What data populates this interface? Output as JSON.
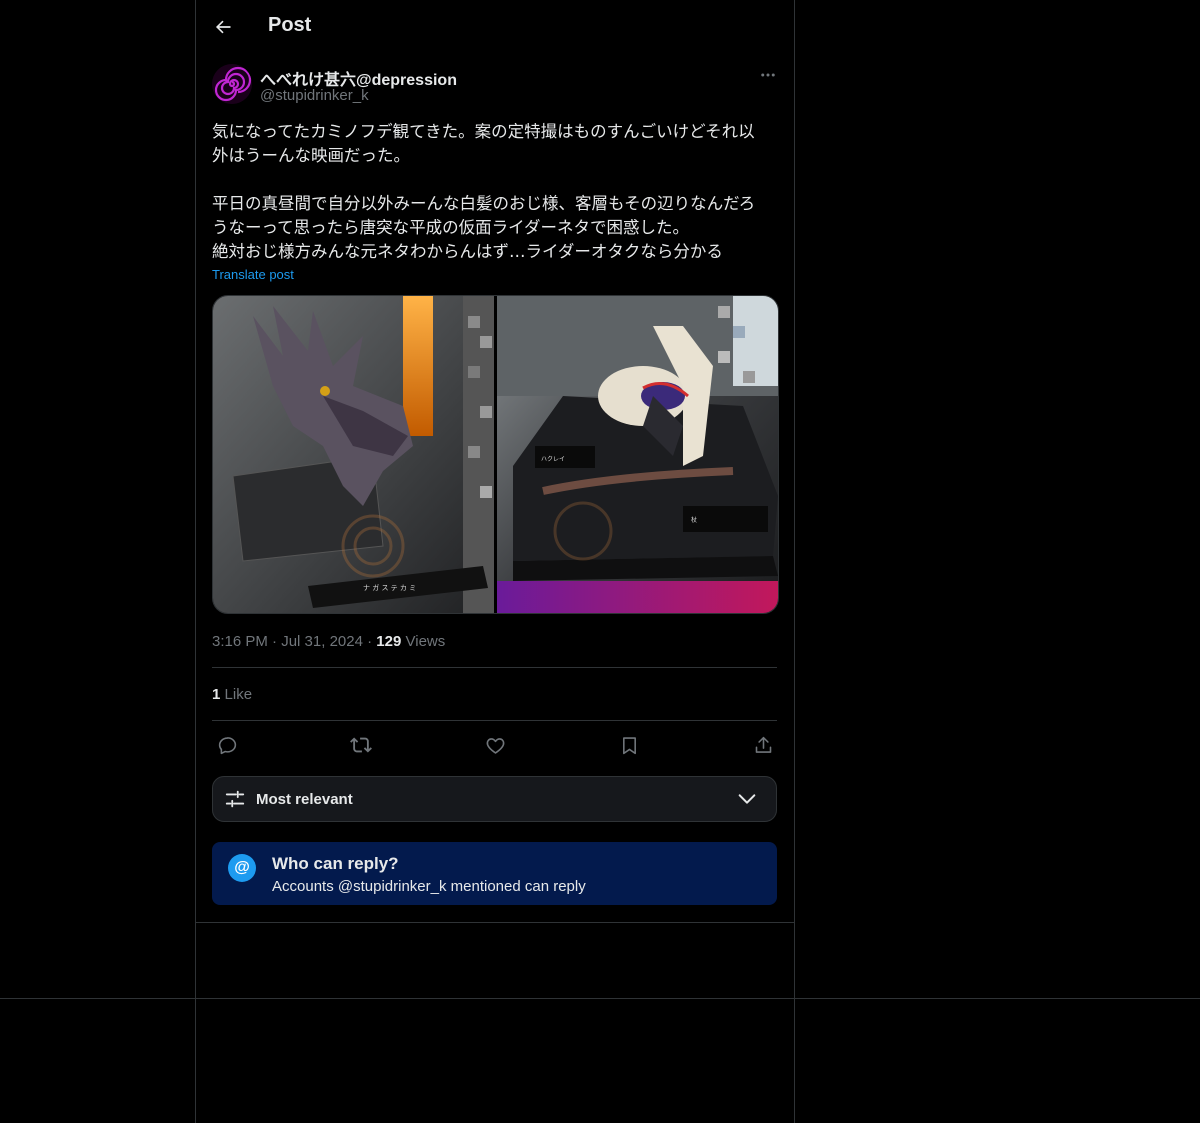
{
  "header": {
    "title": "Post"
  },
  "author": {
    "display_name": "へべれけ甚六@depression",
    "handle": "@stupidrinker_k"
  },
  "post": {
    "paragraph1": [
      "気になってたカミノフデ観てきた。案の定特撮はものすんごいけどそれ以",
      "外はうーんな映画だった。"
    ],
    "paragraph2": [
      "平日の真昼間で自分以外みーんな白髪のおじ様、客層もその辺りなんだろ",
      "うなーって思ったら唐突な平成の仮面ライダーネタで困惑した。",
      "絶対おじ様方みんな元ネタわからんはず…ライダーオタクなら分かる"
    ],
    "translate_label": "Translate post"
  },
  "meta": {
    "time": "3:16 PM",
    "separator": "·",
    "date": "Jul 31, 2024",
    "views_count": "129",
    "views_label": "Views"
  },
  "engagement": {
    "likes_count": "1",
    "likes_label": "Like"
  },
  "actions": [
    "reply-icon",
    "repost-icon",
    "like-icon",
    "bookmark-icon",
    "share-icon"
  ],
  "sort": {
    "label": "Most relevant"
  },
  "reply_restriction": {
    "title": "Who can reply?",
    "subtitle": "Accounts @stupidrinker_k mentioned can reply"
  },
  "colors": {
    "background": "#000000",
    "accent": "#1d9bf0",
    "border": "#2f3336",
    "muted": "#71767b",
    "reply_box": "#031a4d"
  }
}
